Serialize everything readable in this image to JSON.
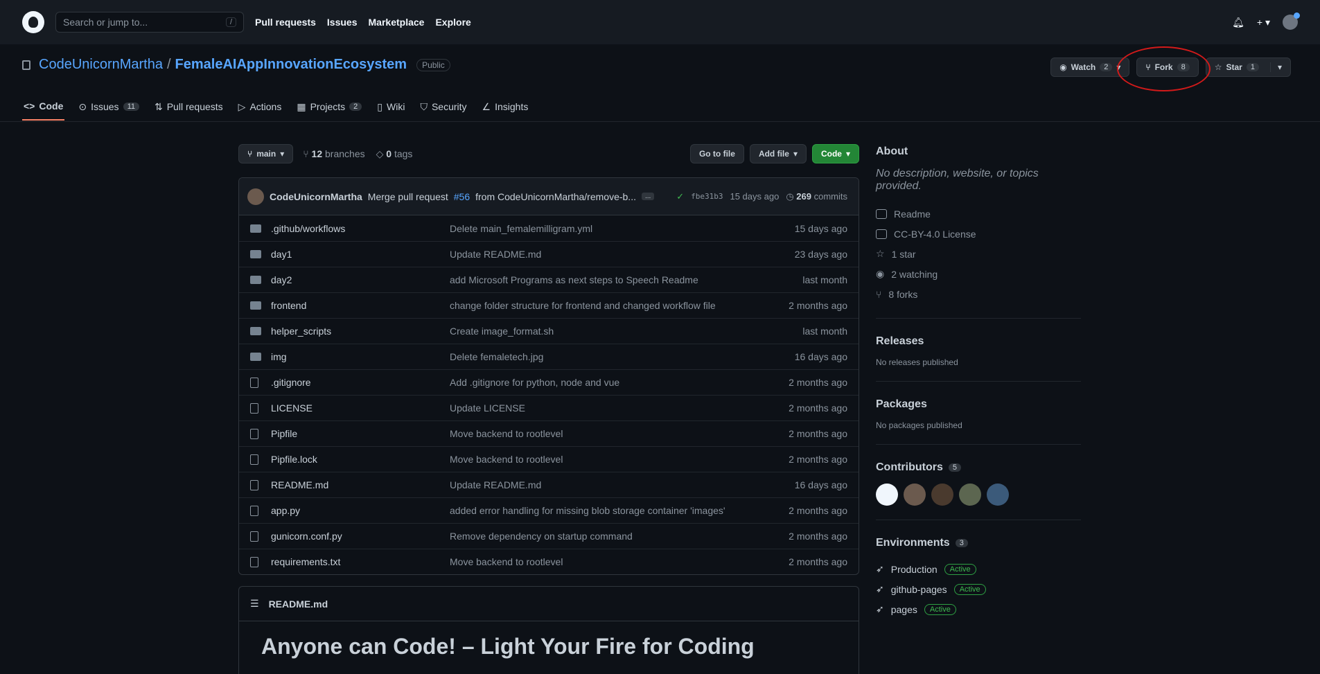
{
  "topbar": {
    "search_placeholder": "Search or jump to...",
    "search_shortcut": "/",
    "nav": [
      "Pull requests",
      "Issues",
      "Marketplace",
      "Explore"
    ]
  },
  "repo": {
    "owner": "CodeUnicornMartha",
    "separator": "/",
    "name": "FemaleAIAppInnovationEcosystem",
    "visibility": "Public"
  },
  "actions": {
    "watch_label": "Watch",
    "watch_count": "2",
    "fork_label": "Fork",
    "fork_count": "8",
    "star_label": "Star",
    "star_count": "1"
  },
  "tabs": [
    {
      "label": "Code",
      "count": ""
    },
    {
      "label": "Issues",
      "count": "11"
    },
    {
      "label": "Pull requests",
      "count": ""
    },
    {
      "label": "Actions",
      "count": ""
    },
    {
      "label": "Projects",
      "count": "2"
    },
    {
      "label": "Wiki",
      "count": ""
    },
    {
      "label": "Security",
      "count": ""
    },
    {
      "label": "Insights",
      "count": ""
    }
  ],
  "branchbar": {
    "branch": "main",
    "branches_count": "12",
    "branches_label": "branches",
    "tags_count": "0",
    "tags_label": "tags",
    "goto_file": "Go to file",
    "add_file": "Add file",
    "code": "Code"
  },
  "commit": {
    "author": "CodeUnicornMartha",
    "message_pre": "Merge pull request",
    "pr_link": "#56",
    "message_post": "from CodeUnicornMartha/remove-b...",
    "ellipsis": "...",
    "sha": "fbe31b3",
    "age": "15 days ago",
    "commits_count": "269",
    "commits_label": "commits"
  },
  "files": [
    {
      "type": "folder",
      "name": ".github/workflows",
      "msg": "Delete main_femalemilligram.yml",
      "age": "15 days ago"
    },
    {
      "type": "folder",
      "name": "day1",
      "msg": "Update README.md",
      "age": "23 days ago"
    },
    {
      "type": "folder",
      "name": "day2",
      "msg": "add Microsoft Programs as next steps to Speech Readme",
      "age": "last month"
    },
    {
      "type": "folder",
      "name": "frontend",
      "msg": "change folder structure for frontend and changed workflow file",
      "age": "2 months ago"
    },
    {
      "type": "folder",
      "name": "helper_scripts",
      "msg": "Create image_format.sh",
      "age": "last month"
    },
    {
      "type": "folder",
      "name": "img",
      "msg": "Delete femaletech.jpg",
      "age": "16 days ago"
    },
    {
      "type": "file",
      "name": ".gitignore",
      "msg": "Add .gitignore for python, node and vue",
      "age": "2 months ago"
    },
    {
      "type": "file",
      "name": "LICENSE",
      "msg": "Update LICENSE",
      "age": "2 months ago"
    },
    {
      "type": "file",
      "name": "Pipfile",
      "msg": "Move backend to rootlevel",
      "age": "2 months ago"
    },
    {
      "type": "file",
      "name": "Pipfile.lock",
      "msg": "Move backend to rootlevel",
      "age": "2 months ago"
    },
    {
      "type": "file",
      "name": "README.md",
      "msg": "Update README.md",
      "age": "16 days ago"
    },
    {
      "type": "file",
      "name": "app.py",
      "msg": "added error handling for missing blob storage container 'images'",
      "age": "2 months ago"
    },
    {
      "type": "file",
      "name": "gunicorn.conf.py",
      "msg": "Remove dependency on startup command",
      "age": "2 months ago"
    },
    {
      "type": "file",
      "name": "requirements.txt",
      "msg": "Move backend to rootlevel",
      "age": "2 months ago"
    }
  ],
  "readme": {
    "filename": "README.md",
    "heading": "Anyone can Code! – Light Your Fire for Coding"
  },
  "sidebar": {
    "about_title": "About",
    "description": "No description, website, or topics provided.",
    "about_items": [
      "Readme",
      "CC-BY-4.0 License",
      "1 star",
      "2 watching",
      "8 forks"
    ],
    "releases_title": "Releases",
    "releases_text": "No releases published",
    "packages_title": "Packages",
    "packages_text": "No packages published",
    "contributors_title": "Contributors",
    "contributors_count": "5",
    "environments_title": "Environments",
    "environments_count": "3",
    "environments": [
      {
        "name": "Production",
        "status": "Active"
      },
      {
        "name": "github-pages",
        "status": "Active"
      },
      {
        "name": "pages",
        "status": "Active"
      }
    ]
  }
}
